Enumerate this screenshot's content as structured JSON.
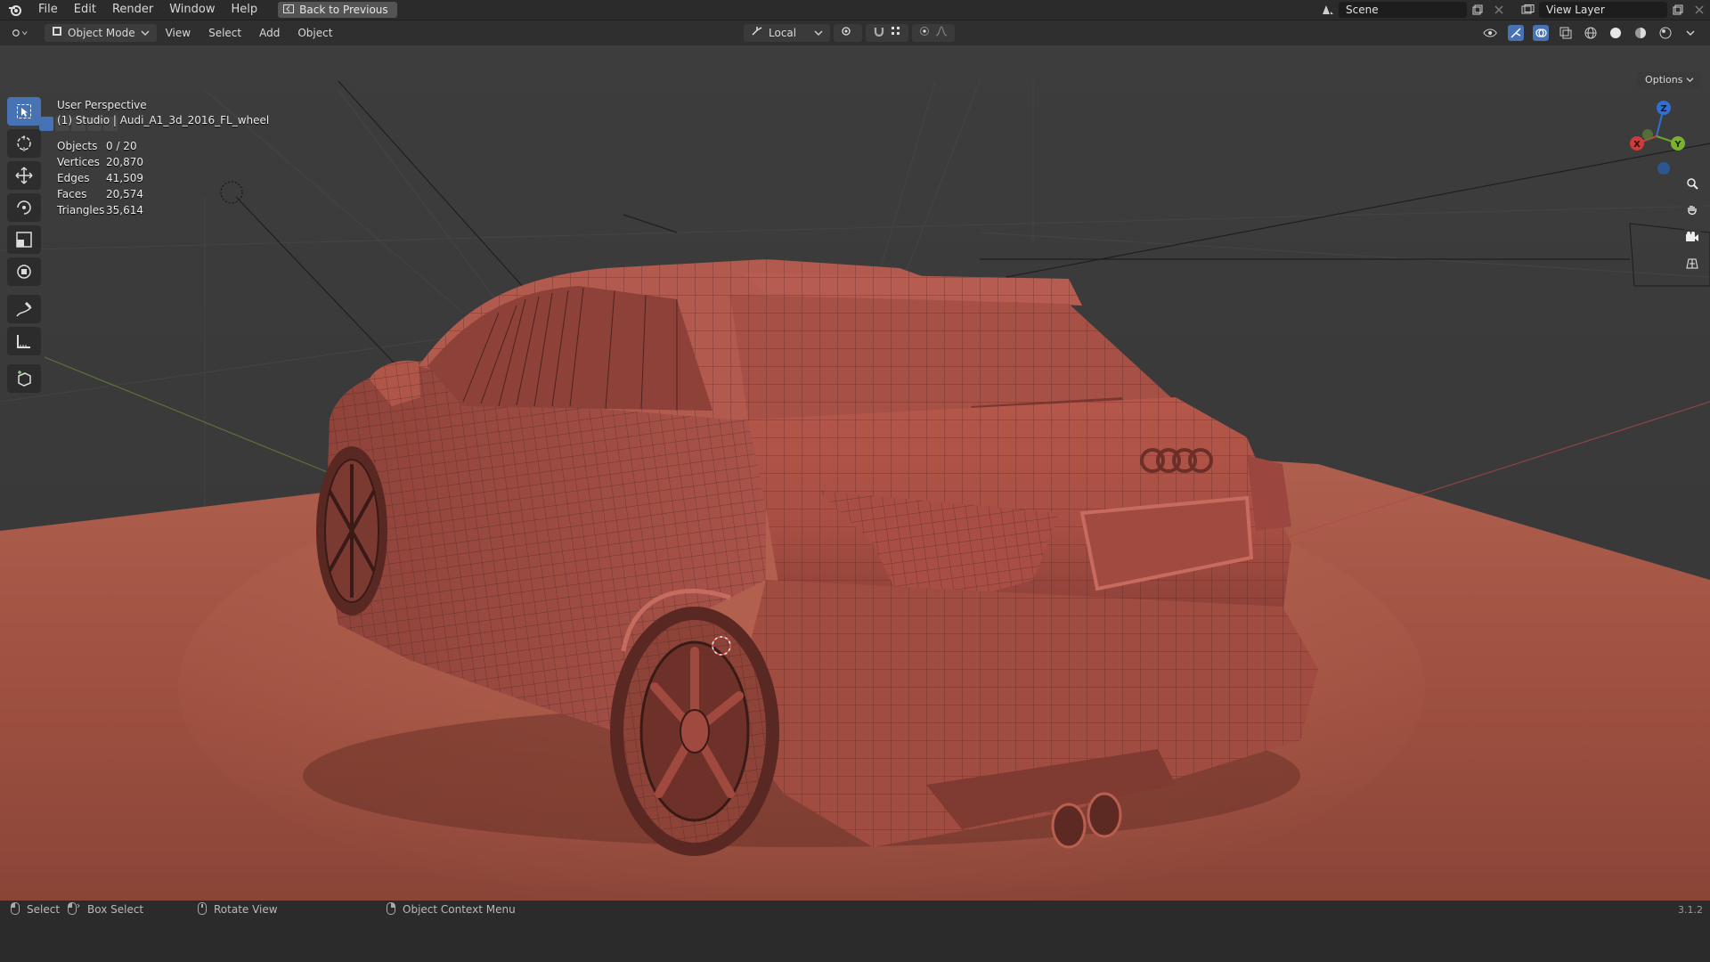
{
  "topbar": {
    "menus": [
      "File",
      "Edit",
      "Render",
      "Window",
      "Help"
    ],
    "back_button": "Back to Previous",
    "scene_field": "Scene",
    "view_layer_field": "View Layer"
  },
  "viewport_header": {
    "mode": "Object Mode",
    "menus": [
      "View",
      "Select",
      "Add",
      "Object"
    ],
    "transform_orientation": "Local"
  },
  "viewport": {
    "perspective_label": "User Perspective",
    "object_label": "(1) Studio | Audi_A1_3d_2016_FL_wheel",
    "options_label": "Options",
    "stats": [
      {
        "label": "Objects",
        "value": "0 / 20"
      },
      {
        "label": "Vertices",
        "value": "20,870"
      },
      {
        "label": "Edges",
        "value": "41,509"
      },
      {
        "label": "Faces",
        "value": "20,574"
      },
      {
        "label": "Triangles",
        "value": "35,614"
      }
    ],
    "gizmo_axes": {
      "x": "X",
      "y": "Y",
      "z": "Z"
    }
  },
  "statusbar": {
    "select": "Select",
    "box_select": "Box Select",
    "rotate_view": "Rotate View",
    "context_menu": "Object Context Menu",
    "version": "3.1.2"
  },
  "colors": {
    "accent": "#4772b3",
    "model": "#b4554a",
    "floor": "#a0513f"
  }
}
